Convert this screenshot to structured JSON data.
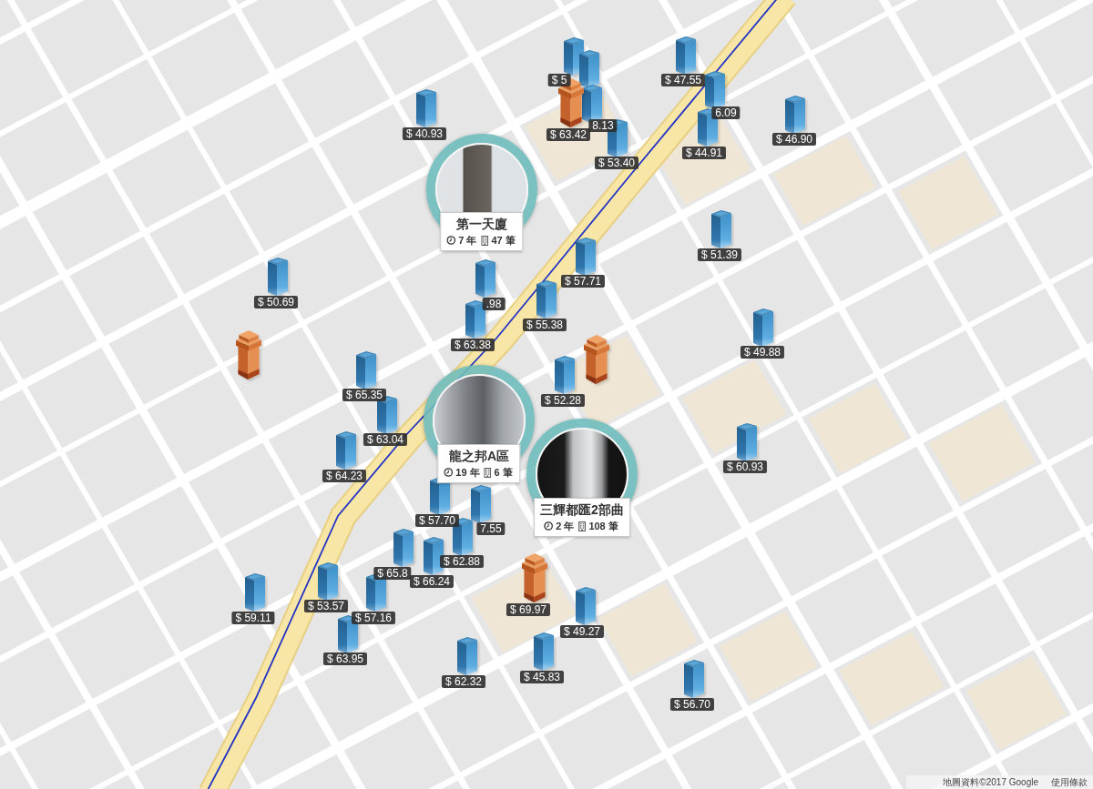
{
  "map": {
    "markers": [
      {
        "kind": "block",
        "price": "$ 5"
      },
      {
        "kind": "block"
      },
      {
        "kind": "pillar",
        "price": "$ 63.42"
      },
      {
        "kind": "block",
        "price": "8.13"
      },
      {
        "kind": "block",
        "price": "$ 40.93"
      },
      {
        "kind": "block",
        "price": "$ 47.55"
      },
      {
        "kind": "block",
        "price": "6.09"
      },
      {
        "kind": "block",
        "price": "$ 44.91"
      },
      {
        "kind": "block",
        "price": "$ 46.90"
      },
      {
        "kind": "block",
        "price": "$ 53.40"
      },
      {
        "kind": "block",
        "price": "$ 51.39"
      },
      {
        "kind": "block",
        "price": "$ 57.71"
      },
      {
        "kind": "block",
        "price": "$ 50.69"
      },
      {
        "kind": "block",
        "price": ".98"
      },
      {
        "kind": "block",
        "price": "$ 63.38"
      },
      {
        "kind": "block",
        "price": "$ 55.38"
      },
      {
        "kind": "pillar"
      },
      {
        "kind": "pillar"
      },
      {
        "kind": "block",
        "price": "$ 49.88"
      },
      {
        "kind": "block",
        "price": "$ 65.35"
      },
      {
        "kind": "block",
        "price": "$ 52.28"
      },
      {
        "kind": "block",
        "price": "$ 63.04"
      },
      {
        "kind": "block",
        "price": "$ 64.23"
      },
      {
        "kind": "block",
        "price": "$ 60.93"
      },
      {
        "kind": "block",
        "price": "$ 57.70"
      },
      {
        "kind": "block",
        "price": "7.55"
      },
      {
        "kind": "block",
        "price": "$ 62.88"
      },
      {
        "kind": "block",
        "price": "$ 65.8"
      },
      {
        "kind": "block",
        "price": "$ 66.24"
      },
      {
        "kind": "block",
        "price": "$ 53.57"
      },
      {
        "kind": "block",
        "price": "$ 57.16"
      },
      {
        "kind": "block",
        "price": "$ 59.11"
      },
      {
        "kind": "pillar",
        "price": "$ 69.97"
      },
      {
        "kind": "block",
        "price": "$ 49.27"
      },
      {
        "kind": "block",
        "price": "$ 63.95"
      },
      {
        "kind": "block",
        "price": "$ 62.32"
      },
      {
        "kind": "block",
        "price": "$ 45.83"
      },
      {
        "kind": "block",
        "price": "$ 56.70"
      }
    ],
    "clusters": [
      {
        "name": "第一天廈",
        "age": "7 年",
        "listings": "47 筆"
      },
      {
        "name": "龍之邦A區",
        "age": "19 年",
        "listings": "6 筆"
      },
      {
        "name": "三輝都匯2部曲",
        "age": "2 年",
        "listings": "108 筆"
      }
    ]
  },
  "attribution": {
    "credit": "地圖資料©2017 Google",
    "terms": "使用條款"
  }
}
